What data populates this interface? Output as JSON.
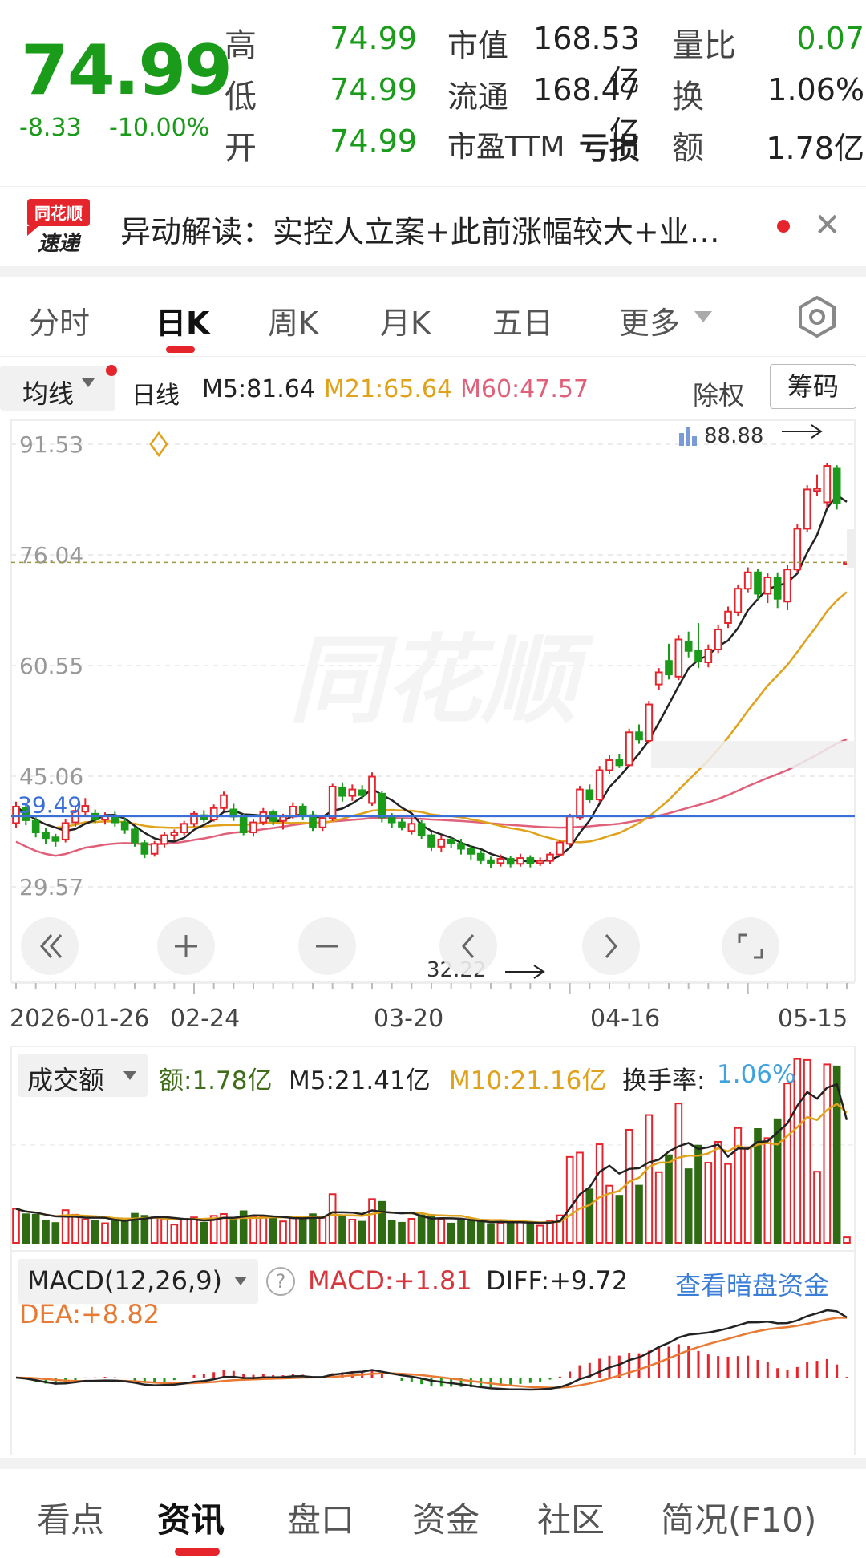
{
  "quote": {
    "price": "74.99",
    "change": "-8.33",
    "change_pct": "-10.00%",
    "high_label": "高",
    "high": "74.99",
    "low_label": "低",
    "low": "74.99",
    "open_label": "开",
    "open": "74.99",
    "mktcap_label": "市值",
    "mktcap": "168.53亿",
    "float_label": "流通",
    "float": "168.47亿",
    "pe_label": "市盈TTM",
    "pe": "亏损",
    "volratio_label": "量比",
    "volratio": "0.07",
    "turnover_label": "换",
    "turnover": "1.06%",
    "amount_label": "额",
    "amount": "1.78亿",
    "up_color": "#e5242b",
    "down_color": "#1a9b1a"
  },
  "news": {
    "logo_top": "同花顺",
    "logo_bottom": "速递",
    "text": "异动解读：实控人立案+此前涨幅较大+业…"
  },
  "tabs": [
    "分时",
    "日K",
    "周K",
    "月K",
    "五日",
    "更多"
  ],
  "active_tab": "日K",
  "settings_icon": "gear-icon",
  "ma": {
    "selector": "均线",
    "period": "日线",
    "m5": "M5:81.64",
    "m21": "M21:65.64",
    "m60": "M60:47.57",
    "m5_color": "#222222",
    "m21_color": "#e0a21a",
    "m60_color": "#e0607a",
    "fq": "除权",
    "chip": "筹码"
  },
  "watermark": "同花顺",
  "price_axis": [
    "91.53",
    "76.04",
    "60.55",
    "45.06",
    "29.57"
  ],
  "price_line_label": "39.49",
  "high_mark": "88.88",
  "low_mark": "32.22",
  "date_axis": [
    "2026-01-26",
    "02-24",
    "03-20",
    "04-16",
    "05-15"
  ],
  "volume": {
    "selector": "成交额",
    "amount": "额:1.78亿",
    "m5": "M5:21.41亿",
    "m10": "M10:21.16亿",
    "turnover_label": "换手率:",
    "turnover": "1.06%"
  },
  "macd": {
    "selector": "MACD(12,26,9)",
    "help": "?",
    "macd": "MACD:+1.81",
    "diff": "DIFF:+9.72",
    "dea": "DEA:+8.82",
    "link": "查看暗盘资金"
  },
  "bottom_nav": [
    "看点",
    "资讯",
    "盘口",
    "资金",
    "社区",
    "简况(F10)"
  ],
  "active_nav": "资讯",
  "chart_data": {
    "type": "candlestick",
    "price_range": [
      29.57,
      91.53
    ],
    "candles": [
      {
        "o": 38.5,
        "c": 40.8,
        "h": 41.5,
        "l": 37.8
      },
      {
        "o": 40.6,
        "c": 38.9,
        "h": 41.0,
        "l": 38.2
      },
      {
        "o": 38.8,
        "c": 37.2,
        "h": 39.3,
        "l": 36.5
      },
      {
        "o": 37.1,
        "c": 36.4,
        "h": 37.8,
        "l": 35.6
      },
      {
        "o": 36.5,
        "c": 36.0,
        "h": 37.0,
        "l": 35.2
      },
      {
        "o": 36.2,
        "c": 38.5,
        "h": 39.0,
        "l": 35.8
      },
      {
        "o": 38.6,
        "c": 40.2,
        "h": 40.8,
        "l": 38.0
      },
      {
        "o": 40.1,
        "c": 40.9,
        "h": 42.0,
        "l": 39.5
      },
      {
        "o": 39.8,
        "c": 39.0,
        "h": 40.4,
        "l": 38.5
      },
      {
        "o": 39.0,
        "c": 39.5,
        "h": 40.0,
        "l": 38.3
      },
      {
        "o": 39.4,
        "c": 38.6,
        "h": 40.1,
        "l": 38.0
      },
      {
        "o": 38.6,
        "c": 37.6,
        "h": 39.2,
        "l": 37.0
      },
      {
        "o": 37.6,
        "c": 35.8,
        "h": 38.0,
        "l": 35.2
      },
      {
        "o": 35.7,
        "c": 34.2,
        "h": 36.2,
        "l": 33.6
      },
      {
        "o": 34.2,
        "c": 35.6,
        "h": 36.0,
        "l": 33.8
      },
      {
        "o": 35.6,
        "c": 36.8,
        "h": 37.2,
        "l": 35.1
      },
      {
        "o": 36.8,
        "c": 37.2,
        "h": 37.6,
        "l": 36.2
      },
      {
        "o": 37.2,
        "c": 38.4,
        "h": 38.8,
        "l": 36.8
      },
      {
        "o": 38.4,
        "c": 39.8,
        "h": 40.2,
        "l": 38.0
      },
      {
        "o": 39.6,
        "c": 39.0,
        "h": 40.3,
        "l": 38.6
      },
      {
        "o": 39.0,
        "c": 40.6,
        "h": 41.1,
        "l": 38.7
      },
      {
        "o": 40.6,
        "c": 42.4,
        "h": 42.9,
        "l": 40.2
      },
      {
        "o": 40.4,
        "c": 39.4,
        "h": 41.2,
        "l": 38.8
      },
      {
        "o": 39.4,
        "c": 37.2,
        "h": 39.8,
        "l": 36.8
      },
      {
        "o": 37.2,
        "c": 38.6,
        "h": 39.0,
        "l": 36.6
      },
      {
        "o": 38.6,
        "c": 40.0,
        "h": 40.6,
        "l": 38.2
      },
      {
        "o": 40.0,
        "c": 38.8,
        "h": 40.4,
        "l": 38.2
      },
      {
        "o": 38.8,
        "c": 39.4,
        "h": 39.8,
        "l": 37.6
      },
      {
        "o": 39.4,
        "c": 40.8,
        "h": 41.4,
        "l": 39.0
      },
      {
        "o": 40.8,
        "c": 39.6,
        "h": 41.2,
        "l": 38.9
      },
      {
        "o": 39.6,
        "c": 37.9,
        "h": 40.2,
        "l": 37.4
      },
      {
        "o": 37.9,
        "c": 39.2,
        "h": 39.6,
        "l": 37.4
      },
      {
        "o": 39.2,
        "c": 43.6,
        "h": 44.0,
        "l": 38.8
      },
      {
        "o": 43.5,
        "c": 42.3,
        "h": 44.2,
        "l": 41.5
      },
      {
        "o": 42.3,
        "c": 43.2,
        "h": 43.9,
        "l": 41.6
      },
      {
        "o": 43.1,
        "c": 42.4,
        "h": 43.8,
        "l": 41.9
      },
      {
        "o": 41.3,
        "c": 45.0,
        "h": 45.6,
        "l": 40.9
      },
      {
        "o": 42.6,
        "c": 39.3,
        "h": 43.0,
        "l": 38.6
      },
      {
        "o": 39.3,
        "c": 38.6,
        "h": 39.9,
        "l": 37.8
      },
      {
        "o": 38.6,
        "c": 38.0,
        "h": 39.2,
        "l": 37.5
      },
      {
        "o": 37.4,
        "c": 38.4,
        "h": 39.3,
        "l": 36.9
      },
      {
        "o": 38.4,
        "c": 36.8,
        "h": 38.9,
        "l": 36.3
      },
      {
        "o": 36.8,
        "c": 35.2,
        "h": 37.3,
        "l": 34.6
      },
      {
        "o": 35.2,
        "c": 36.2,
        "h": 36.8,
        "l": 34.5
      },
      {
        "o": 36.2,
        "c": 35.7,
        "h": 36.6,
        "l": 35.0
      },
      {
        "o": 35.6,
        "c": 34.9,
        "h": 36.3,
        "l": 34.1
      },
      {
        "o": 34.9,
        "c": 34.2,
        "h": 35.4,
        "l": 33.4
      },
      {
        "o": 34.2,
        "c": 33.3,
        "h": 34.7,
        "l": 32.7
      },
      {
        "o": 33.3,
        "c": 32.9,
        "h": 33.8,
        "l": 32.22
      },
      {
        "o": 32.9,
        "c": 33.5,
        "h": 34.1,
        "l": 32.4
      },
      {
        "o": 33.5,
        "c": 32.8,
        "h": 33.9,
        "l": 32.3
      },
      {
        "o": 32.8,
        "c": 33.6,
        "h": 34.2,
        "l": 32.4
      },
      {
        "o": 33.6,
        "c": 32.9,
        "h": 34.0,
        "l": 32.3
      },
      {
        "o": 32.9,
        "c": 33.2,
        "h": 33.7,
        "l": 32.5
      },
      {
        "o": 33.2,
        "c": 34.1,
        "h": 34.5,
        "l": 32.8
      },
      {
        "o": 34.1,
        "c": 35.8,
        "h": 36.2,
        "l": 33.8
      },
      {
        "o": 35.6,
        "c": 39.4,
        "h": 39.8,
        "l": 35.2
      },
      {
        "o": 39.3,
        "c": 43.2,
        "h": 43.7,
        "l": 38.9
      },
      {
        "o": 43.1,
        "c": 41.8,
        "h": 43.9,
        "l": 41.3
      },
      {
        "o": 41.8,
        "c": 45.9,
        "h": 46.5,
        "l": 41.4
      },
      {
        "o": 45.9,
        "c": 47.3,
        "h": 48.0,
        "l": 45.4
      },
      {
        "o": 47.3,
        "c": 46.6,
        "h": 48.2,
        "l": 46.2
      },
      {
        "o": 46.6,
        "c": 51.2,
        "h": 51.7,
        "l": 46.3
      },
      {
        "o": 51.2,
        "c": 50.2,
        "h": 52.3,
        "l": 49.6
      },
      {
        "o": 50.0,
        "c": 55.1,
        "h": 55.6,
        "l": 49.6
      },
      {
        "o": 57.9,
        "c": 59.6,
        "h": 60.2,
        "l": 57.1
      },
      {
        "o": 61.2,
        "c": 59.3,
        "h": 63.6,
        "l": 58.6
      },
      {
        "o": 59.0,
        "c": 64.2,
        "h": 64.8,
        "l": 58.5
      },
      {
        "o": 63.9,
        "c": 62.6,
        "h": 65.3,
        "l": 61.7
      },
      {
        "o": 62.6,
        "c": 61.1,
        "h": 66.5,
        "l": 60.2
      },
      {
        "o": 61.0,
        "c": 62.8,
        "h": 63.5,
        "l": 60.3
      },
      {
        "o": 62.8,
        "c": 65.6,
        "h": 66.3,
        "l": 62.3
      },
      {
        "o": 66.5,
        "c": 68.1,
        "h": 68.8,
        "l": 65.8
      },
      {
        "o": 68.0,
        "c": 71.3,
        "h": 71.9,
        "l": 67.5
      },
      {
        "o": 71.3,
        "c": 73.6,
        "h": 74.3,
        "l": 70.8
      },
      {
        "o": 73.6,
        "c": 70.6,
        "h": 74.1,
        "l": 69.8
      },
      {
        "o": 70.6,
        "c": 72.9,
        "h": 73.5,
        "l": 69.3
      },
      {
        "o": 72.9,
        "c": 69.9,
        "h": 73.6,
        "l": 68.6
      },
      {
        "o": 69.5,
        "c": 74.0,
        "h": 74.6,
        "l": 68.3
      },
      {
        "o": 74.0,
        "c": 79.7,
        "h": 80.3,
        "l": 73.6
      },
      {
        "o": 79.7,
        "c": 85.2,
        "h": 85.8,
        "l": 79.2
      },
      {
        "o": 85.0,
        "c": 85.3,
        "h": 87.3,
        "l": 84.3
      },
      {
        "o": 83.4,
        "c": 88.5,
        "h": 88.88,
        "l": 82.7
      },
      {
        "o": 88.1,
        "c": 83.3,
        "h": 88.6,
        "l": 82.4
      },
      {
        "o": 74.99,
        "c": 74.99,
        "h": 74.99,
        "l": 74.99
      }
    ],
    "ma5_end": 81.64,
    "ma21_end": 65.64,
    "ma60_end": 47.57,
    "horizontal_line": 39.49,
    "volume": {
      "latest": 1.78,
      "m5": 21.41,
      "m10": 21.16
    },
    "macd": {
      "macd": 1.81,
      "diff": 9.72,
      "dea": 8.82
    }
  }
}
